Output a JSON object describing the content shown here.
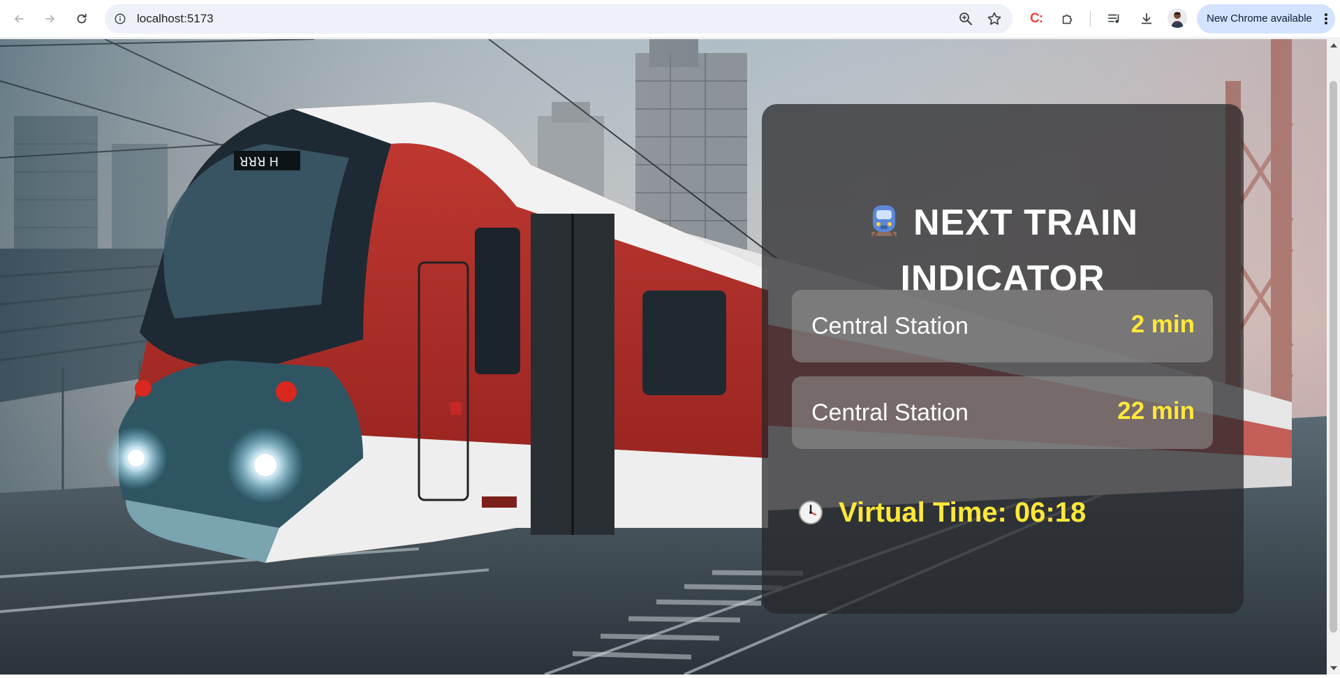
{
  "browser": {
    "url": "localhost:5173",
    "update_label": "New Chrome available",
    "icons": [
      "back-arrow-icon",
      "forward-arrow-icon",
      "reload-icon",
      "site-info-icon",
      "zoom-icon",
      "bookmark-star-icon",
      "extension-c-icon",
      "extensions-puzzle-icon",
      "media-queue-icon",
      "download-icon",
      "profile-avatar",
      "more-vertical-icon"
    ],
    "extension_label": "C:"
  },
  "indicator": {
    "icon": "metro-train-icon",
    "title_line1": "NEXT TRAIN",
    "title_line2": "INDICATOR",
    "arrivals": [
      {
        "station": "Central Station",
        "eta": "2 min"
      },
      {
        "station": "Central Station",
        "eta": "22 min"
      }
    ],
    "virtual_time_icon": "clock-icon",
    "virtual_time_text": "Virtual Time: 06:18"
  },
  "colors": {
    "eta": "#ffe83a",
    "panel": "#262628",
    "update_pill": "#d3e3fd",
    "train_red": "#b3261e"
  }
}
